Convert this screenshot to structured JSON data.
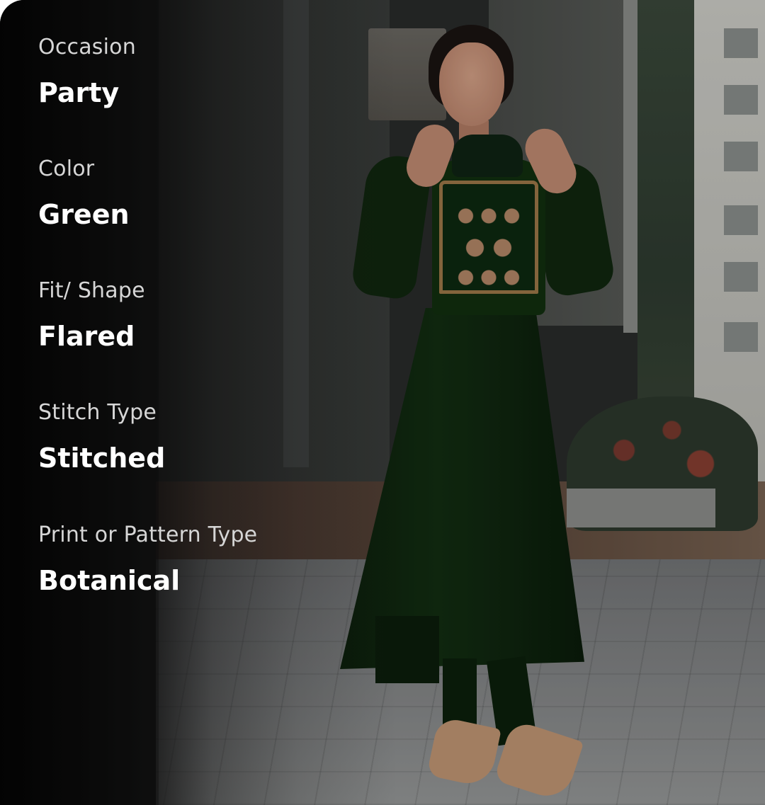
{
  "product_details": {
    "attributes": [
      {
        "label": "Occasion",
        "value": "Party"
      },
      {
        "label": "Color",
        "value": "Green"
      },
      {
        "label": "Fit/ Shape",
        "value": "Flared"
      },
      {
        "label": "Stitch Type",
        "value": "Stitched"
      },
      {
        "label": "Print or Pattern Type",
        "value": "Botanical"
      }
    ]
  },
  "colors": {
    "label": "#d6d6d6",
    "value": "#ffffff",
    "panel": "#000000",
    "dress": "#12300f"
  }
}
